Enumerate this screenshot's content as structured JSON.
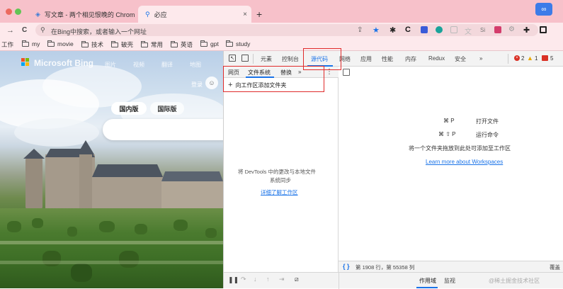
{
  "browser": {
    "tabs": [
      {
        "title": "写文章 - 两个相见恨晚的 Chrom",
        "close": "×"
      },
      {
        "title": "必应",
        "close": "×"
      }
    ],
    "new_tab": "+",
    "nav": {
      "forward": "→",
      "reload": "C"
    },
    "address_placeholder": "在Bing中搜索，或者输入一个网址",
    "extension_label": "Si"
  },
  "bookmarks": {
    "cut_label": "工作",
    "items": [
      "my",
      "movie",
      "技术",
      "破壳",
      "常用",
      "英语",
      "gpt",
      "study"
    ]
  },
  "bing": {
    "brand": "Microsoft Bing",
    "nav": [
      "图片",
      "视频",
      "翻译",
      "地图"
    ],
    "login": "登录",
    "pills": [
      "国内版",
      "国际版"
    ]
  },
  "devtools": {
    "tabs": [
      "元素",
      "控制台",
      "源代码",
      "网络",
      "应用",
      "性能",
      "内存",
      "Redux",
      "安全",
      "»"
    ],
    "selected_tab": "源代码",
    "badges": {
      "errors": "2",
      "warnings": "1",
      "messages": "5"
    },
    "subtabs": [
      "网页",
      "文件系统",
      "替换",
      "»"
    ],
    "add_folder": "向工作区添加文件夹",
    "sync_text_line1": "将 DevTools 中的更改与本地文件",
    "sync_text_line2": "系统同步",
    "learn_more": "详细了解工作区",
    "shortcuts": [
      {
        "keys": "⌘ P",
        "action": "打开文件"
      },
      {
        "keys": "⌘ ⇧ P",
        "action": "运行命令"
      }
    ],
    "drop_hint": "将一个文件夹拖放到此处可添加至工作区",
    "workspaces_link": "Learn more about Workspaces",
    "status": "第 1908 行，第 55358 列",
    "status_right": "覆盖",
    "bottom_tabs": [
      "作用域",
      "监视"
    ],
    "watermark": "@稀土掘金技术社区"
  },
  "colors": {
    "accent": "#1a73e8",
    "highlight": "#e02b2b",
    "tabbar": "#f7c1ca"
  }
}
